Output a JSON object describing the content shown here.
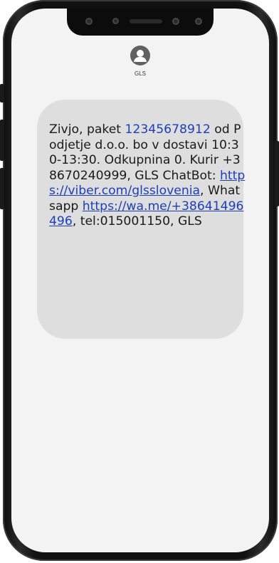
{
  "contact": {
    "name": "GLS",
    "avatar_icon": "person-avatar-icon"
  },
  "message": {
    "text_1": "Zivjo, paket ",
    "tracking_number": "12345678912",
    "text_2": " od Podjetje d.o.o. bo v dostavi 10:30-13:30. Odkupnina 0. Kurir +38670240999, GLS ChatBot: ",
    "viber_link": "https://viber.com/glsslovenia",
    "text_3": ", Whatsapp ",
    "whatsapp_link": "https://wa.me/+38641496496",
    "text_4": ",  tel:015001150, GLS"
  },
  "colors": {
    "bubble": "#dedede",
    "link": "#1c3fb8",
    "screen": "#f3f3f3",
    "frame": "#111111"
  }
}
